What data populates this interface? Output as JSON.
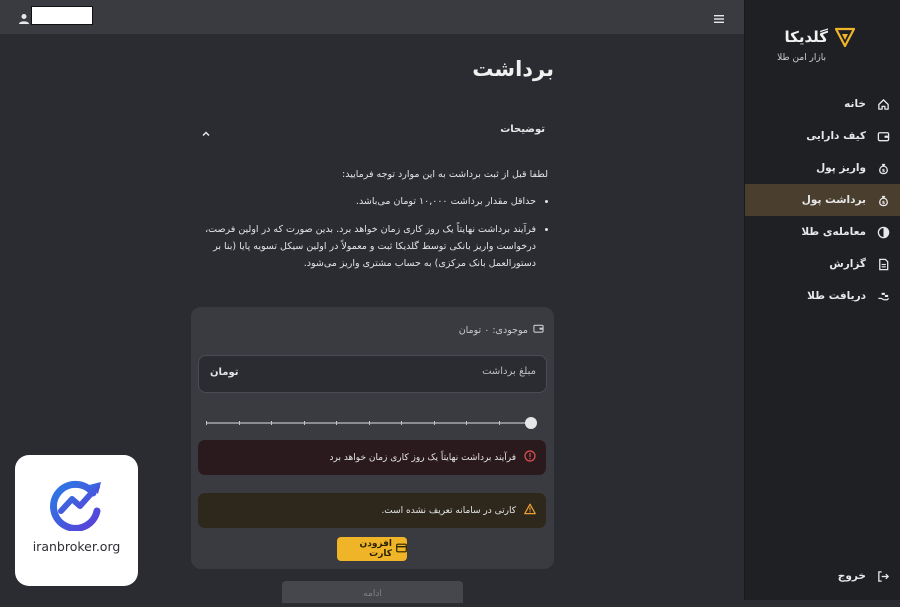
{
  "sidebar": {
    "brand_name": "گلدیکا",
    "brand_tagline": "بازار امن طلا",
    "items": [
      {
        "label": "خانه",
        "icon": "home-icon"
      },
      {
        "label": "کیف دارایی",
        "icon": "wallet-icon"
      },
      {
        "label": "واریز پول",
        "icon": "money-bag-icon"
      },
      {
        "label": "برداشت پول",
        "icon": "money-bag-icon",
        "active": true
      },
      {
        "label": "معامله‌ی طلا",
        "icon": "exchange-icon"
      },
      {
        "label": "گزارش",
        "icon": "document-icon"
      },
      {
        "label": "دریافت طلا",
        "icon": "hand-receive-icon"
      }
    ],
    "logout_label": "خروج"
  },
  "header": {
    "menu_icon": "hamburger-icon",
    "user_icon": "user-icon"
  },
  "main": {
    "title": "برداشت",
    "accordion_title": "توضیحات",
    "intro": "لطفا قبل از ثبت برداشت به این موارد توجه فرمایید:",
    "notes": [
      "حداقل مقدار برداشت ۱۰,۰۰۰ تومان می‌باشد.",
      "فرآیند برداشت نهایتاً یک روز کاری زمان خواهد برد. بدین صورت که در اولین فرصت، درخواست واریز بانکی توسط گلدیکا ثبت و معمولاً در اولین سیکل تسویه پایا (بنا بر دستورالعمل بانک مرکزی) به حساب مشتری واریز می‌شود."
    ]
  },
  "form": {
    "balance_text": "موجودی: ۰ تومان",
    "amount_placeholder": "مبلغ برداشت",
    "currency_label": "تومان",
    "slider_value_percent": 100,
    "error_text": "فرآیند برداشت نهایتاً یک روز کاری زمان خواهد برد",
    "warning_text": "کارتی در سامانه تعریف نشده است.",
    "add_card_label": "افزودن کارت",
    "continue_label": "ادامه"
  },
  "watermark": {
    "text": "iranbroker.org"
  },
  "colors": {
    "accent": "#f0b429",
    "sidebar_active": "#4a3f2e",
    "error_bg": "#2a1a1d",
    "warning_bg": "#2e281c",
    "error_icon": "#e05252",
    "warning_icon": "#f0a030"
  }
}
